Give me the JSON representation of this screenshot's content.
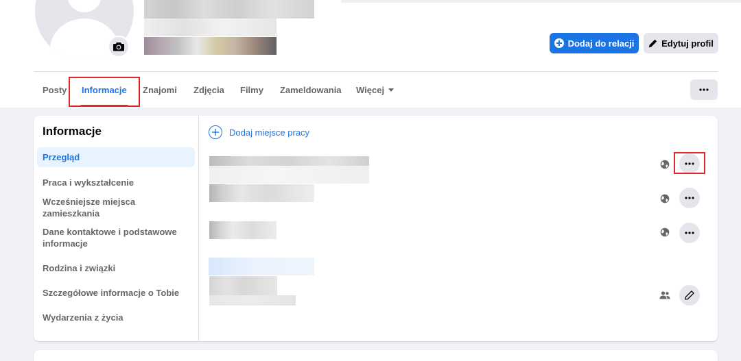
{
  "header": {
    "add_story_label": "Dodaj do relacji",
    "edit_profile_label": "Edytuj profil"
  },
  "tabs": [
    {
      "label": "Posty",
      "active": false
    },
    {
      "label": "Informacje",
      "active": true
    },
    {
      "label": "Znajomi",
      "active": false
    },
    {
      "label": "Zdjęcia",
      "active": false
    },
    {
      "label": "Filmy",
      "active": false
    },
    {
      "label": "Zameldowania",
      "active": false
    },
    {
      "label": "Więcej",
      "active": false
    }
  ],
  "about": {
    "title": "Informacje",
    "sidebar": [
      {
        "label": "Przegląd",
        "active": true
      },
      {
        "label": "Praca i wykształcenie"
      },
      {
        "label": "Wcześniejsze miejsca zamieszkania"
      },
      {
        "label": "Dane kontaktowe i podstawowe informacje"
      },
      {
        "label": "Rodzina i związki"
      },
      {
        "label": "Szczegółowe informacje o Tobie"
      },
      {
        "label": "Wydarzenia z życia"
      }
    ],
    "add_workplace_label": "Dodaj miejsce pracy"
  },
  "colors": {
    "accent": "#1b74e4",
    "highlight": "#e0262c",
    "secondary_bg": "#e4e6eb",
    "muted_text": "#65676b"
  },
  "icons": {
    "camera": "camera-icon",
    "plus": "plus-icon",
    "pencil": "pencil-icon",
    "more": "more-horizontal-icon",
    "globe": "globe-icon",
    "friends": "friends-icon",
    "caret": "caret-down-icon"
  }
}
